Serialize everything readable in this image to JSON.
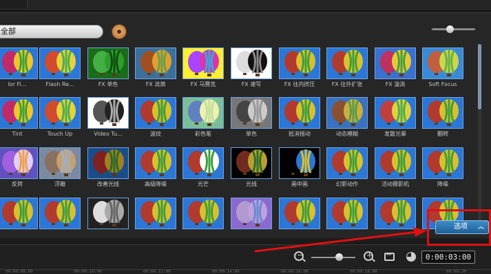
{
  "filter": {
    "selected": "全部"
  },
  "effects": [
    [
      "lor Fi...",
      "Flash Re...",
      "FX 单色",
      "FX 涟漪",
      "FX 马赛克",
      "FX 速写",
      "FX 往内挤压",
      "FX 往外扩张",
      "FX 漩涡",
      "Soft Focus"
    ],
    [
      "Tint",
      "Touch Up",
      "Video Tu...",
      "波纹",
      "彩色笔",
      "单色",
      "抵消摇动",
      "动态模糊",
      "发散光晕",
      "翻转"
    ],
    [
      "反转",
      "浮雕",
      "改善光线",
      "高级降噪",
      "光芒",
      "光线",
      "画中画",
      "幻影动作",
      "活动摄影机",
      "降噪"
    ],
    [
      "",
      "",
      "",
      "",
      "",
      "",
      "",
      "",
      "",
      ""
    ]
  ],
  "options_button": {
    "label": "选项",
    "icon": "double-chevron-up-icon"
  },
  "timecode": "0:00:03:00",
  "ruler_ticks": [
    "00:00:08:00",
    "00:00:10:00",
    "00:00:12:00",
    "00:00:14:00",
    "00:00:16:00",
    "00:00:18:00",
    "00:00:20"
  ],
  "colors": {
    "accent": "#2f7bbf",
    "highlight": "#e01010",
    "thumb_border": "#6aa6e8"
  }
}
